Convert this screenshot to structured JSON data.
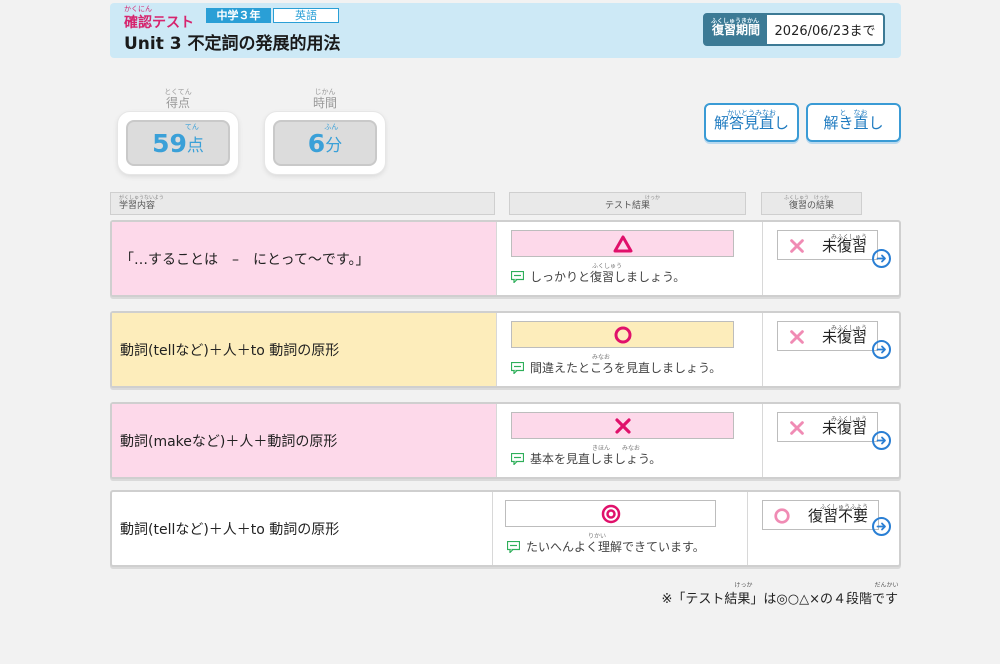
{
  "header": {
    "kind": "確認テスト",
    "kind_ruby": "かくにん",
    "grade": "中学３年",
    "subject": "英語",
    "title": "Unit 3 不定詞の発展的用法",
    "deadline_label": "復習期間",
    "deadline_ruby": "ふくしゅうきかん",
    "deadline_value": "2026/06/23まで"
  },
  "score": {
    "label": "得点",
    "label_ruby": "とくてん",
    "value": "59",
    "unit": "点",
    "unit_ruby": "てん"
  },
  "time": {
    "label": "時間",
    "label_ruby": "じかん",
    "value": "6",
    "unit": "分",
    "unit_ruby": "ふん"
  },
  "buttons": {
    "review_answers": "解答見直し",
    "review_answers_ruby": "かいとうみなお",
    "resolve": "解き直し",
    "resolve_ruby": "と　なお"
  },
  "columns": {
    "topic": "学習内容",
    "topic_ruby": "がくしゅうないよう",
    "result": "テスト結果",
    "result_ruby": "けっか",
    "review": "復習の結果",
    "review_ruby": "ふくしゅう　けっか"
  },
  "rows": [
    {
      "topic": "「…することは　–　にとって～です。」",
      "result_mark": "triangle",
      "comment": "しっかりと復習しましょう。",
      "comment_ruby": "ふくしゅう",
      "review_mark": "cross",
      "review_text": "未復習",
      "review_ruby": "みふくしゅう"
    },
    {
      "topic": "動詞(tellなど)＋人＋to 動詞の原形",
      "result_mark": "circle",
      "comment": "間違えたところを見直しましょう。",
      "comment_ruby": "みなお",
      "review_mark": "cross",
      "review_text": "未復習",
      "review_ruby": "みふくしゅう"
    },
    {
      "topic": "動詞(makeなど)＋人＋動詞の原形",
      "result_mark": "cross",
      "comment": "基本を見直しましょう。",
      "comment_ruby": "きほん　　みなお",
      "review_mark": "cross",
      "review_text": "未復習",
      "review_ruby": "みふくしゅう"
    },
    {
      "topic": "動詞(tellなど)＋人＋to 動詞の原形",
      "result_mark": "double-circle",
      "comment": "たいへんよく理解できています。",
      "comment_ruby": "りかい",
      "review_mark": "circle",
      "review_text": "復習不要",
      "review_ruby": "ふくしゅうふよう"
    }
  ],
  "note": "※「テスト結果」は◎○△×の４段階です",
  "note_ruby_1": "けっか",
  "note_ruby_2": "だんかい",
  "colors": {
    "accent": "#2a9fd6",
    "pink_bg": "#fdd9ea",
    "yellow_bg": "#fdedbb",
    "mark_pink": "#e0116b",
    "mark_light_pink": "#f08bb4",
    "arrow_blue": "#2a7fd4"
  }
}
